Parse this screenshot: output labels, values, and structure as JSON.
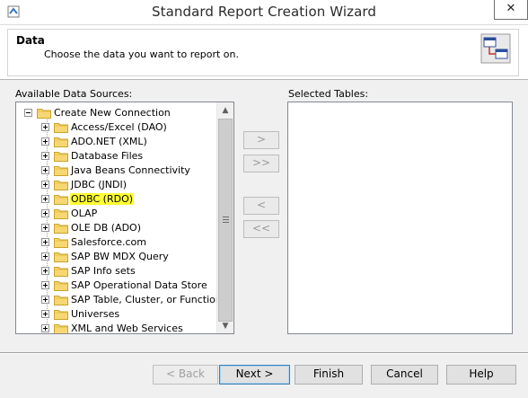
{
  "window": {
    "title": "Standard Report Creation Wizard",
    "close_glyph": "✕"
  },
  "header": {
    "title": "Data",
    "description": "Choose the data you want to report on."
  },
  "available": {
    "label": "Available Data Sources:",
    "root": "Create New Connection",
    "items": [
      {
        "label": "Access/Excel (DAO)",
        "highlighted": false
      },
      {
        "label": "ADO.NET (XML)",
        "highlighted": false
      },
      {
        "label": "Database Files",
        "highlighted": false
      },
      {
        "label": "Java Beans Connectivity",
        "highlighted": false
      },
      {
        "label": "JDBC (JNDI)",
        "highlighted": false
      },
      {
        "label": "ODBC (RDO)",
        "highlighted": true
      },
      {
        "label": "OLAP",
        "highlighted": false
      },
      {
        "label": "OLE DB (ADO)",
        "highlighted": false
      },
      {
        "label": "Salesforce.com",
        "highlighted": false
      },
      {
        "label": "SAP BW MDX Query",
        "highlighted": false
      },
      {
        "label": "SAP Info sets",
        "highlighted": false
      },
      {
        "label": "SAP Operational Data Store",
        "highlighted": false
      },
      {
        "label": "SAP Table, Cluster, or Function",
        "highlighted": false
      },
      {
        "label": "Universes",
        "highlighted": false
      },
      {
        "label": "XML and Web Services",
        "highlighted": false
      }
    ],
    "highlight_color": "#ffff33"
  },
  "selected": {
    "label": "Selected Tables:"
  },
  "move_buttons": {
    "add": ">",
    "add_all": ">>",
    "remove": "<",
    "remove_all": "<<"
  },
  "buttons": {
    "back": "< Back",
    "next": "Next >",
    "finish": "Finish",
    "cancel": "Cancel",
    "help": "Help"
  },
  "icons": {
    "app": "wizard-app-icon",
    "data": "data-tables-icon",
    "folder": "folder-icon"
  }
}
